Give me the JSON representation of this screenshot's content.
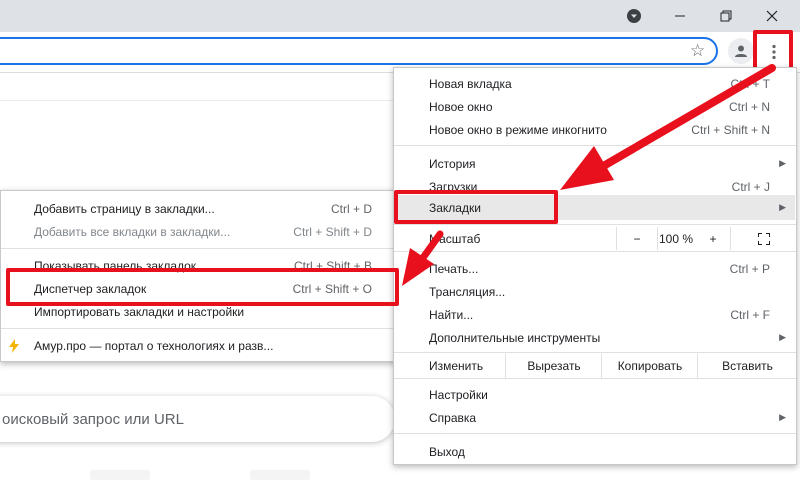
{
  "search": {
    "placeholder": "оисковый запрос или URL"
  },
  "menu": {
    "items": [
      {
        "label": "Новая вкладка",
        "shortcut": "Ctrl + T"
      },
      {
        "label": "Новое окно",
        "shortcut": "Ctrl + N"
      },
      {
        "label": "Новое окно в режиме инкогнито",
        "shortcut": "Ctrl + Shift + N"
      },
      {
        "label": "История",
        "shortcut": ""
      },
      {
        "label": "Загрузки",
        "shortcut": "Ctrl + J"
      },
      {
        "label": "Закладки",
        "shortcut": ""
      },
      {
        "label": "Масштаб",
        "shortcut": ""
      },
      {
        "label": "Печать...",
        "shortcut": "Ctrl + P"
      },
      {
        "label": "Трансляция...",
        "shortcut": ""
      },
      {
        "label": "Найти...",
        "shortcut": "Ctrl + F"
      },
      {
        "label": "Дополнительные инструменты",
        "shortcut": ""
      },
      {
        "label": "Настройки",
        "shortcut": ""
      },
      {
        "label": "Справка",
        "shortcut": ""
      },
      {
        "label": "Выход",
        "shortcut": ""
      }
    ],
    "zoom": {
      "minus": "−",
      "value": "100 %",
      "plus": "+"
    },
    "edit": {
      "label": "Изменить",
      "cut": "Вырезать",
      "copy": "Копировать",
      "paste": "Вставить"
    }
  },
  "submenu": {
    "items": [
      {
        "label": "Добавить страницу в закладки...",
        "shortcut": "Ctrl + D"
      },
      {
        "label": "Добавить все вкладки в закладки...",
        "shortcut": "Ctrl + Shift + D"
      },
      {
        "label": "Показывать панель закладок",
        "shortcut": "Ctrl + Shift + B"
      },
      {
        "label": "Диспетчер закладок",
        "shortcut": "Ctrl + Shift + O"
      },
      {
        "label": "Импортировать закладки и настройки",
        "shortcut": ""
      },
      {
        "label": "Амур.про — портал о технологиях и разв...",
        "shortcut": ""
      }
    ]
  },
  "colors": {
    "accent": "#1a73e8",
    "callout": "#e8101c",
    "bookmark_icon": "#f2b600",
    "titlebar": "#dee1e6"
  },
  "icons": {
    "titlebar": [
      "profile-dropdown-icon",
      "minimize-icon",
      "restore-icon",
      "close-icon"
    ],
    "toolbar": [
      "star-icon",
      "account-icon",
      "more-vert-icon"
    ],
    "menu": [
      "chevron-right-icon",
      "fullscreen-icon"
    ],
    "bookmark": "lightning-bolt-icon"
  }
}
